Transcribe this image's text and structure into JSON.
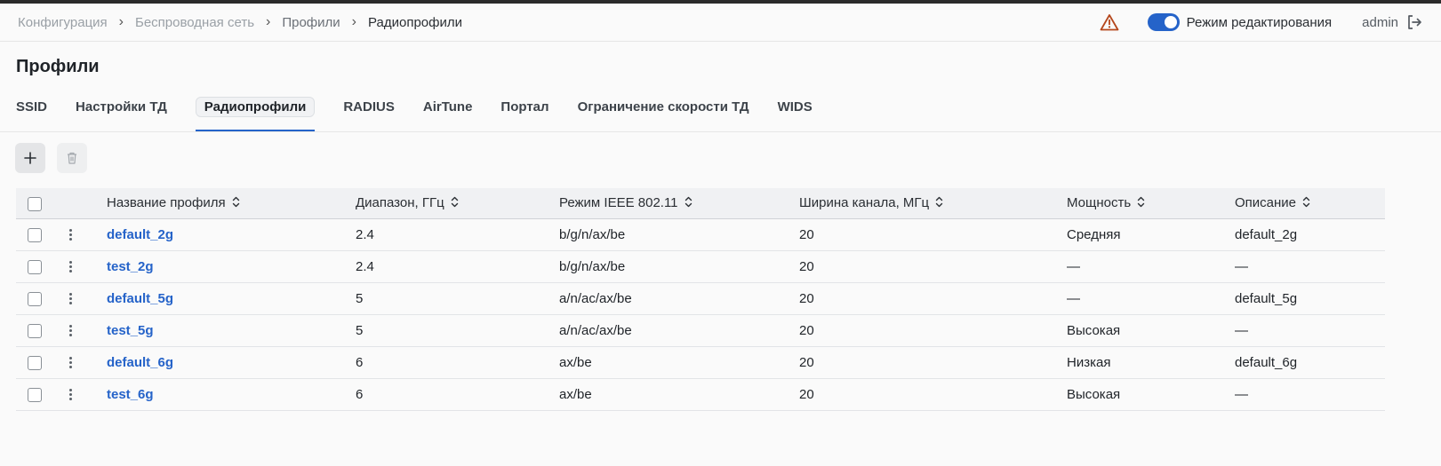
{
  "breadcrumb": {
    "items": [
      "Конфигурация",
      "Беспроводная сеть",
      "Профили",
      "Радиопрофили"
    ]
  },
  "header": {
    "edit_mode_label": "Режим редактирования",
    "edit_mode_on": true,
    "user": "admin",
    "accent_color": "#2563c9",
    "warning_color": "#b5471c"
  },
  "page": {
    "title": "Профили"
  },
  "tabs": [
    {
      "label": "SSID"
    },
    {
      "label": "Настройки ТД"
    },
    {
      "label": "Радиопрофили",
      "active": true
    },
    {
      "label": "RADIUS"
    },
    {
      "label": "AirTune"
    },
    {
      "label": "Портал"
    },
    {
      "label": "Ограничение скорости ТД"
    },
    {
      "label": "WIDS"
    }
  ],
  "toolbar": {
    "add_icon": "plus-icon",
    "delete_icon": "trash-icon"
  },
  "table": {
    "columns": [
      "Название профиля",
      "Диапазон, ГГц",
      "Режим IEEE 802.11",
      "Ширина канала, МГц",
      "Мощность",
      "Описание"
    ],
    "rows": [
      {
        "name": "default_2g",
        "band": "2.4",
        "mode": "b/g/n/ax/be",
        "width": "20",
        "power": "Средняя",
        "desc": "default_2g"
      },
      {
        "name": "test_2g",
        "band": "2.4",
        "mode": "b/g/n/ax/be",
        "width": "20",
        "power": "—",
        "desc": "—"
      },
      {
        "name": "default_5g",
        "band": "5",
        "mode": "a/n/ac/ax/be",
        "width": "20",
        "power": "—",
        "desc": "default_5g"
      },
      {
        "name": "test_5g",
        "band": "5",
        "mode": "a/n/ac/ax/be",
        "width": "20",
        "power": "Высокая",
        "desc": "—"
      },
      {
        "name": "default_6g",
        "band": "6",
        "mode": "ax/be",
        "width": "20",
        "power": "Низкая",
        "desc": "default_6g"
      },
      {
        "name": "test_6g",
        "band": "6",
        "mode": "ax/be",
        "width": "20",
        "power": "Высокая",
        "desc": "—"
      }
    ]
  }
}
